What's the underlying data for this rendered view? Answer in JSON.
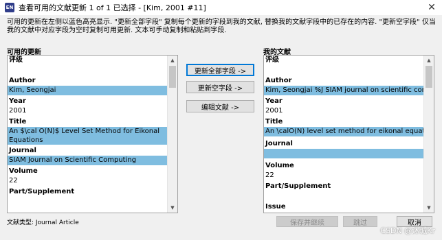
{
  "window": {
    "title": "查看可用的文献更新 1 of 1 已选择 - [Kim, 2001 #11]",
    "app_icon_label": "EN",
    "close_glyph": "✕"
  },
  "description": "可用的更新在左侧以蓝色高亮显示. \"更新全部字段\" 复制每个更新的字段到我的文献, 替换我的文献字段中的已存在的内容. \"更新空字段\" 仅当我的文献中对应字段为空时复制可用更新. 文本可手动复制和粘贴到字段.",
  "left_panel": {
    "label": "可用的更新",
    "rating_label": "评级",
    "author_label": "Author",
    "author_value": "Kim, Seongjai",
    "year_label": "Year",
    "year_value": "2001",
    "title_label": "Title",
    "title_value": "An $\\cal O(N)$ Level Set Method for Eikonal Equations",
    "journal_label": "Journal",
    "journal_value": "SIAM Journal on Scientific Computing",
    "volume_label": "Volume",
    "volume_value": "22",
    "part_label": "Part/Supplement"
  },
  "right_panel": {
    "label": "我的文献",
    "rating_label": "评级",
    "author_label": "Author",
    "author_value": "Kim, Seongjai %J SIAM journal on scientific computing",
    "year_label": "Year",
    "year_value": "2001",
    "title_label": "Title",
    "title_value": "An \\calO(N) level set method for eikonal equations",
    "journal_label": "Journal",
    "journal_value": "",
    "volume_label": "Volume",
    "volume_value": "22",
    "part_label": "Part/Supplement",
    "issue_label": "Issue"
  },
  "buttons": {
    "update_all": "更新全部字段 ->",
    "update_empty": "更新空字段 ->",
    "edit_ref": "编辑文献 ->",
    "save_continue": "保存并继续",
    "skip": "跳过",
    "cancel": "取消"
  },
  "footer": {
    "doc_type": "文献类型: Journal Article"
  },
  "watermark": "CSDN @沐城Kr",
  "colors": {
    "highlight": "#7fbde0",
    "primary_border": "#0078d7"
  },
  "icons": {
    "scroll_up": "▲",
    "scroll_down": "▼"
  }
}
